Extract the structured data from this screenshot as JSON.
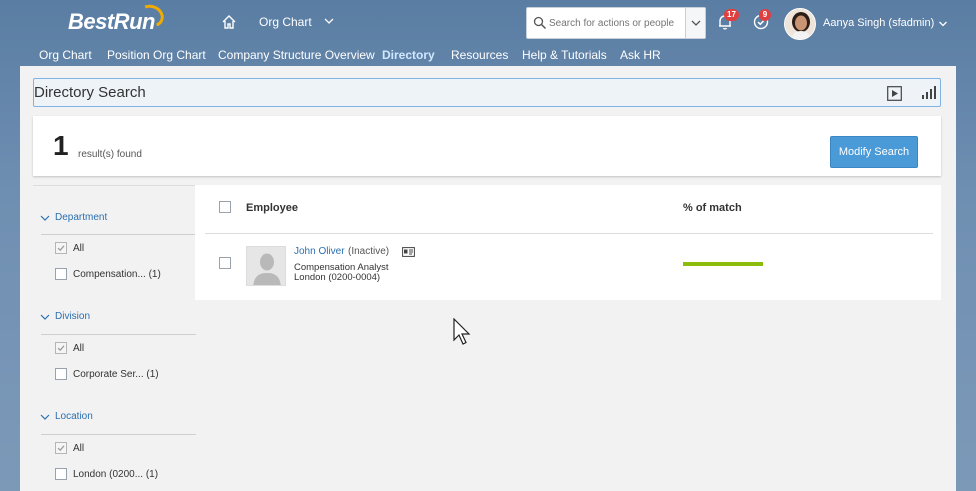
{
  "shell": {
    "logo_text": "BestRun",
    "app_title": "Org Chart",
    "search_placeholder": "Search for actions or people",
    "notifications_count": "17",
    "todo_count": "9",
    "user_name": "Aanya Singh (sfadmin)"
  },
  "nav": {
    "items": [
      "Org Chart",
      "Position Org Chart",
      "Company Structure Overview",
      "Directory",
      "Resources",
      "Help & Tutorials",
      "Ask HR"
    ],
    "active_index": 3
  },
  "page": {
    "title": "Directory Search"
  },
  "results": {
    "count": "1",
    "label": "result(s) found",
    "modify_button": "Modify Search"
  },
  "filters": {
    "department": {
      "header": "Department",
      "options": [
        {
          "label": "All",
          "checked": true
        },
        {
          "label": "Compensation... (1)",
          "checked": false
        }
      ]
    },
    "division": {
      "header": "Division",
      "options": [
        {
          "label": "All",
          "checked": true
        },
        {
          "label": "Corporate Ser... (1)",
          "checked": false
        }
      ]
    },
    "location": {
      "header": "Location",
      "options": [
        {
          "label": "All",
          "checked": true
        },
        {
          "label": "London (0200... (1)",
          "checked": false
        }
      ]
    }
  },
  "table": {
    "col_employee": "Employee",
    "col_match": "% of match",
    "rows": [
      {
        "name": "John Oliver",
        "status": "(Inactive)",
        "title": "Compensation Analyst",
        "location": "London (0200-0004)",
        "match": 1.0
      }
    ]
  },
  "colors": {
    "accent": "#4a9ad8",
    "match_bar": "#8cbc0c",
    "notification_badge": "#e03f3f"
  }
}
